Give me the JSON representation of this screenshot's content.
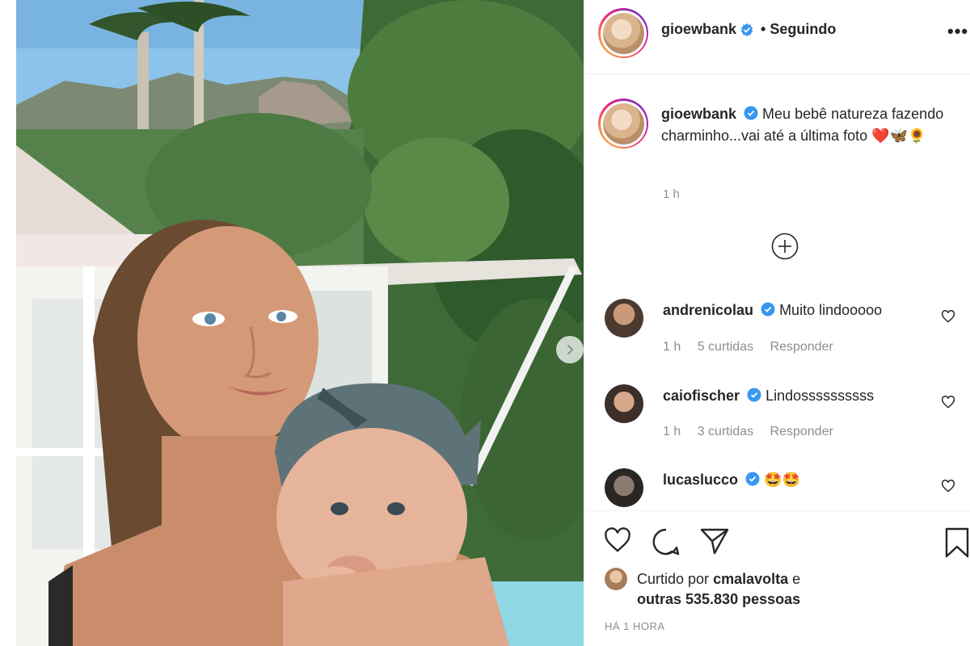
{
  "post": {
    "author": "gioewbank",
    "follow_status": "• Seguindo",
    "more_label": "•••",
    "caption": "Meu bebê natureza fazendo charminho...vai até a última foto ❤️🦋🌻",
    "caption_time": "1 h"
  },
  "comments": [
    {
      "user": "andrenicolau",
      "text": "Muito lindooooo",
      "time": "1 h",
      "likes": "5 curtidas",
      "reply": "Responder"
    },
    {
      "user": "caiofischer",
      "text": "Lindossssssssss",
      "time": "1 h",
      "likes": "3 curtidas",
      "reply": "Responder"
    },
    {
      "user": "lucaslucco",
      "text": "🤩🤩"
    }
  ],
  "likes": {
    "prefix": "Curtido por",
    "user": "cmalavolta",
    "conj": "e",
    "others": "outras 535.830 pessoas"
  },
  "timestamp": "HÁ 1 HORA",
  "colors": {
    "verified": "#3897f0",
    "muted": "#8e8e8e",
    "text": "#262626"
  },
  "icons": [
    "verified-badge-icon",
    "add-comment-icon",
    "heart-icon",
    "comment-icon",
    "share-icon",
    "bookmark-icon",
    "chevron-right-icon"
  ]
}
